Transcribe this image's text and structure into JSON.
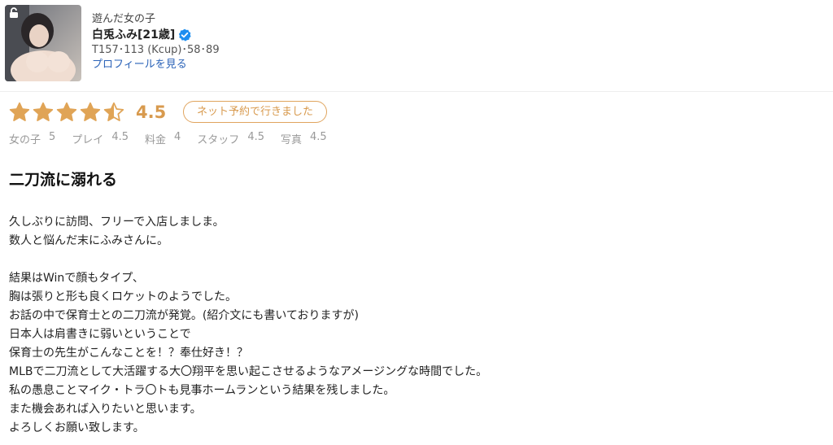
{
  "profile": {
    "label": "遊んだ女の子",
    "name": "白兎ふみ[21歳]",
    "stats": "T157･113 (Kcup)･58･89",
    "link": "プロフィールを見る",
    "icons": {
      "lock": "lock-icon",
      "verified": "verified-check-icon"
    },
    "accent": "#2b63b8"
  },
  "review": {
    "rating": 4.5,
    "score": "4.5",
    "badge": "ネット予約で行きました",
    "star_color": "#e0a456",
    "subratings": [
      {
        "label": "女の子",
        "value": "5"
      },
      {
        "label": "プレイ",
        "value": "4.5"
      },
      {
        "label": "料金",
        "value": "4"
      },
      {
        "label": "スタッフ",
        "value": "4.5"
      },
      {
        "label": "写真",
        "value": "4.5"
      }
    ],
    "title": "二刀流に溺れる",
    "body_lines": [
      "久しぶりに訪問、フリーで入店しましま。",
      "数人と悩んだ末にふみさんに。",
      "",
      "結果はWinで顔もタイプ、",
      "胸は張りと形も良くロケットのようでした。",
      "お話の中で保育士との二刀流が発覚。(紹介文にも書いておりますが)",
      "日本人は肩書きに弱いということで",
      "保育士の先生がこんなことを！？奉仕好き！？",
      "MLBで二刀流として大活躍する大〇翔平を思い起こさせるようなアメージングな時間でした。",
      "私の愚息ことマイク・トラ〇トも見事ホームランという結果を残しました。",
      "また機会あれば入りたいと思います。",
      "よろしくお願い致します。"
    ]
  }
}
